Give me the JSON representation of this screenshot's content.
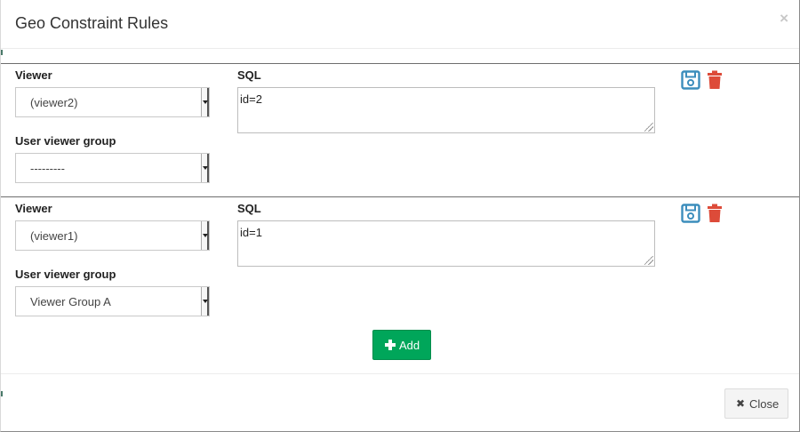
{
  "modal": {
    "title": "Geo Constraint Rules",
    "close_glyph": "×"
  },
  "labels": {
    "viewer": "Viewer",
    "sql": "SQL",
    "user_viewer_group": "User viewer group"
  },
  "rules": [
    {
      "viewer": "(viewer2)",
      "sql": "id=2",
      "user_viewer_group": "---------"
    },
    {
      "viewer": "(viewer1)",
      "sql": "id=1",
      "user_viewer_group": "Viewer Group A"
    }
  ],
  "icons": {
    "save": "floppy-disk-icon",
    "delete": "trash-icon",
    "add": "plus-icon",
    "close": "times-icon"
  },
  "colors": {
    "save_icon": "#3c8dbc",
    "delete_icon": "#dd4b39",
    "add_button": "#00a65a",
    "close_button": "#f4f4f4"
  },
  "buttons": {
    "add_label": "Add",
    "close_label": "Close",
    "close_glyph": "✖"
  }
}
